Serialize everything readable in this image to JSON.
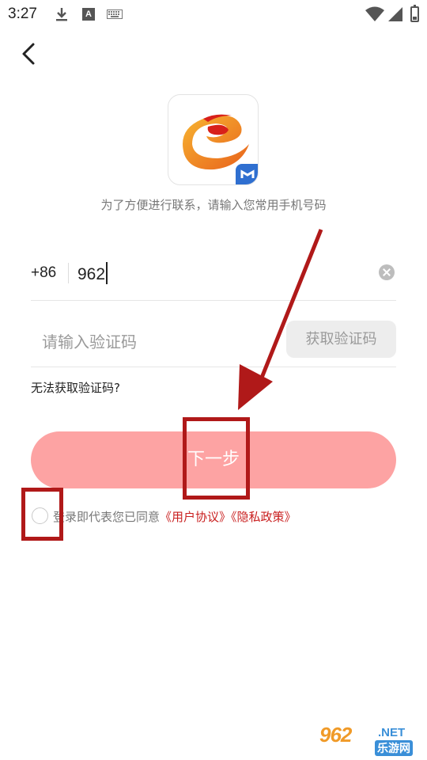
{
  "status_bar": {
    "time": "3:27",
    "icons": [
      "download-icon",
      "a-badge-icon",
      "keyboard-icon",
      "wifi-icon",
      "signal-icon",
      "battery-icon"
    ],
    "a_badge": "A"
  },
  "nav": {
    "back_icon": "chevron-left-icon"
  },
  "subtitle": "为了方便进行联系，请输入您常用手机号码",
  "phone": {
    "country_code": "+86",
    "value": "962",
    "clear_icon": "clear-icon"
  },
  "code": {
    "placeholder": "请输入验证码",
    "get_code_label": "获取验证码"
  },
  "cant_get_code": "无法获取验证码?",
  "next_label": "下一步",
  "agreement": {
    "prefix": "登录即代表您已同意",
    "user_agreement": "《用户协议》",
    "privacy_policy": "《隐私政策》",
    "checked": false
  },
  "watermark": {
    "main": "962",
    "net": ".NET",
    "sub": "乐游网"
  },
  "colors": {
    "accent_button": "#fda3a3",
    "link": "#c91f1f",
    "annotation": "#b01919",
    "text_muted": "#777777"
  }
}
